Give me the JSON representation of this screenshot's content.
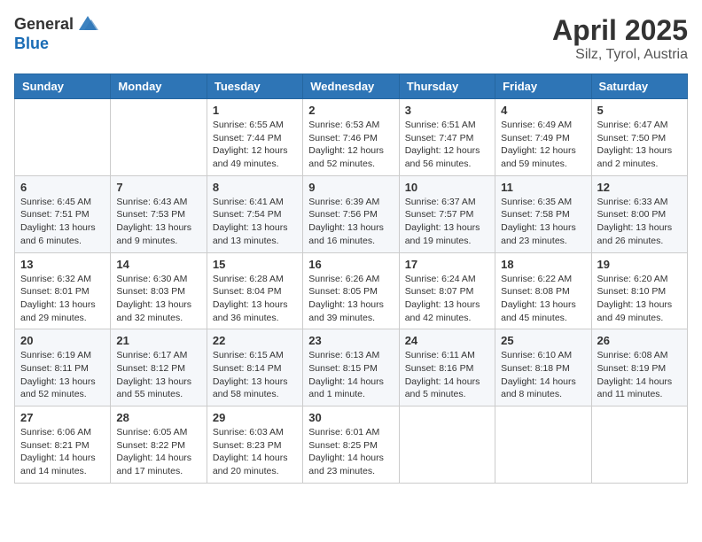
{
  "header": {
    "logo_general": "General",
    "logo_blue": "Blue",
    "month_title": "April 2025",
    "location": "Silz, Tyrol, Austria"
  },
  "weekdays": [
    "Sunday",
    "Monday",
    "Tuesday",
    "Wednesday",
    "Thursday",
    "Friday",
    "Saturday"
  ],
  "weeks": [
    [
      {
        "day": "",
        "info": ""
      },
      {
        "day": "",
        "info": ""
      },
      {
        "day": "1",
        "info": "Sunrise: 6:55 AM\nSunset: 7:44 PM\nDaylight: 12 hours\nand 49 minutes."
      },
      {
        "day": "2",
        "info": "Sunrise: 6:53 AM\nSunset: 7:46 PM\nDaylight: 12 hours\nand 52 minutes."
      },
      {
        "day": "3",
        "info": "Sunrise: 6:51 AM\nSunset: 7:47 PM\nDaylight: 12 hours\nand 56 minutes."
      },
      {
        "day": "4",
        "info": "Sunrise: 6:49 AM\nSunset: 7:49 PM\nDaylight: 12 hours\nand 59 minutes."
      },
      {
        "day": "5",
        "info": "Sunrise: 6:47 AM\nSunset: 7:50 PM\nDaylight: 13 hours\nand 2 minutes."
      }
    ],
    [
      {
        "day": "6",
        "info": "Sunrise: 6:45 AM\nSunset: 7:51 PM\nDaylight: 13 hours\nand 6 minutes."
      },
      {
        "day": "7",
        "info": "Sunrise: 6:43 AM\nSunset: 7:53 PM\nDaylight: 13 hours\nand 9 minutes."
      },
      {
        "day": "8",
        "info": "Sunrise: 6:41 AM\nSunset: 7:54 PM\nDaylight: 13 hours\nand 13 minutes."
      },
      {
        "day": "9",
        "info": "Sunrise: 6:39 AM\nSunset: 7:56 PM\nDaylight: 13 hours\nand 16 minutes."
      },
      {
        "day": "10",
        "info": "Sunrise: 6:37 AM\nSunset: 7:57 PM\nDaylight: 13 hours\nand 19 minutes."
      },
      {
        "day": "11",
        "info": "Sunrise: 6:35 AM\nSunset: 7:58 PM\nDaylight: 13 hours\nand 23 minutes."
      },
      {
        "day": "12",
        "info": "Sunrise: 6:33 AM\nSunset: 8:00 PM\nDaylight: 13 hours\nand 26 minutes."
      }
    ],
    [
      {
        "day": "13",
        "info": "Sunrise: 6:32 AM\nSunset: 8:01 PM\nDaylight: 13 hours\nand 29 minutes."
      },
      {
        "day": "14",
        "info": "Sunrise: 6:30 AM\nSunset: 8:03 PM\nDaylight: 13 hours\nand 32 minutes."
      },
      {
        "day": "15",
        "info": "Sunrise: 6:28 AM\nSunset: 8:04 PM\nDaylight: 13 hours\nand 36 minutes."
      },
      {
        "day": "16",
        "info": "Sunrise: 6:26 AM\nSunset: 8:05 PM\nDaylight: 13 hours\nand 39 minutes."
      },
      {
        "day": "17",
        "info": "Sunrise: 6:24 AM\nSunset: 8:07 PM\nDaylight: 13 hours\nand 42 minutes."
      },
      {
        "day": "18",
        "info": "Sunrise: 6:22 AM\nSunset: 8:08 PM\nDaylight: 13 hours\nand 45 minutes."
      },
      {
        "day": "19",
        "info": "Sunrise: 6:20 AM\nSunset: 8:10 PM\nDaylight: 13 hours\nand 49 minutes."
      }
    ],
    [
      {
        "day": "20",
        "info": "Sunrise: 6:19 AM\nSunset: 8:11 PM\nDaylight: 13 hours\nand 52 minutes."
      },
      {
        "day": "21",
        "info": "Sunrise: 6:17 AM\nSunset: 8:12 PM\nDaylight: 13 hours\nand 55 minutes."
      },
      {
        "day": "22",
        "info": "Sunrise: 6:15 AM\nSunset: 8:14 PM\nDaylight: 13 hours\nand 58 minutes."
      },
      {
        "day": "23",
        "info": "Sunrise: 6:13 AM\nSunset: 8:15 PM\nDaylight: 14 hours\nand 1 minute."
      },
      {
        "day": "24",
        "info": "Sunrise: 6:11 AM\nSunset: 8:16 PM\nDaylight: 14 hours\nand 5 minutes."
      },
      {
        "day": "25",
        "info": "Sunrise: 6:10 AM\nSunset: 8:18 PM\nDaylight: 14 hours\nand 8 minutes."
      },
      {
        "day": "26",
        "info": "Sunrise: 6:08 AM\nSunset: 8:19 PM\nDaylight: 14 hours\nand 11 minutes."
      }
    ],
    [
      {
        "day": "27",
        "info": "Sunrise: 6:06 AM\nSunset: 8:21 PM\nDaylight: 14 hours\nand 14 minutes."
      },
      {
        "day": "28",
        "info": "Sunrise: 6:05 AM\nSunset: 8:22 PM\nDaylight: 14 hours\nand 17 minutes."
      },
      {
        "day": "29",
        "info": "Sunrise: 6:03 AM\nSunset: 8:23 PM\nDaylight: 14 hours\nand 20 minutes."
      },
      {
        "day": "30",
        "info": "Sunrise: 6:01 AM\nSunset: 8:25 PM\nDaylight: 14 hours\nand 23 minutes."
      },
      {
        "day": "",
        "info": ""
      },
      {
        "day": "",
        "info": ""
      },
      {
        "day": "",
        "info": ""
      }
    ]
  ]
}
